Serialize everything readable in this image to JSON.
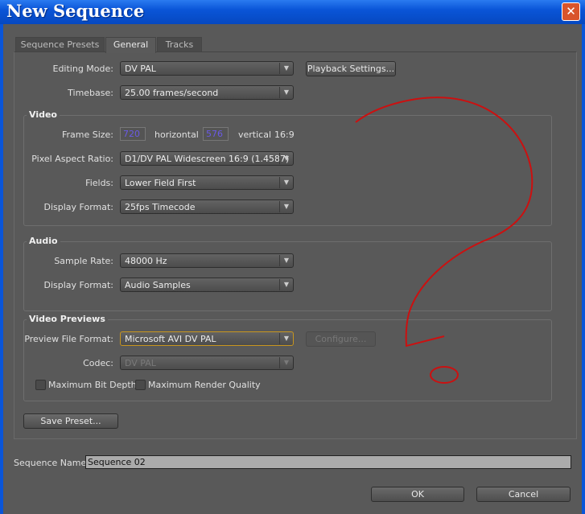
{
  "window": {
    "title": "New Sequence",
    "close": "✕"
  },
  "tabs": [
    {
      "label": "Sequence Presets"
    },
    {
      "label": "General"
    },
    {
      "label": "Tracks"
    }
  ],
  "general": {
    "editing_mode": {
      "label": "Editing Mode:",
      "value": "DV PAL"
    },
    "playback_settings": "Playback Settings...",
    "timebase": {
      "label": "Timebase:",
      "value": "25.00 frames/second"
    }
  },
  "video": {
    "title": "Video",
    "frame_size": {
      "label": "Frame Size:",
      "h": "720",
      "h_label": "horizontal",
      "v": "576",
      "v_label": "vertical",
      "aspect": "16:9"
    },
    "pixel_aspect": {
      "label": "Pixel Aspect Ratio:",
      "value": "D1/DV PAL Widescreen 16:9 (1.4587)"
    },
    "fields": {
      "label": "Fields:",
      "value": "Lower Field First"
    },
    "display_format": {
      "label": "Display Format:",
      "value": "25fps Timecode"
    }
  },
  "audio": {
    "title": "Audio",
    "sample_rate": {
      "label": "Sample Rate:",
      "value": "48000 Hz"
    },
    "display_format": {
      "label": "Display Format:",
      "value": "Audio Samples"
    }
  },
  "previews": {
    "title": "Video Previews",
    "file_format": {
      "label": "Preview File Format:",
      "value": "Microsoft AVI DV PAL"
    },
    "configure": "Configure...",
    "codec": {
      "label": "Codec:",
      "value": "DV PAL"
    },
    "max_bit_depth": {
      "label": "Maximum Bit Depth",
      "checked": false
    },
    "max_render_quality": {
      "label": "Maximum Render Quality",
      "checked": false
    }
  },
  "save_preset": "Save Preset...",
  "sequence_name": {
    "label": "Sequence Name:",
    "value": "Sequence 02"
  },
  "ok": "OK",
  "cancel": "Cancel",
  "colors": {
    "annotation": "#cc1010",
    "titlebar": "#0a55d8"
  }
}
